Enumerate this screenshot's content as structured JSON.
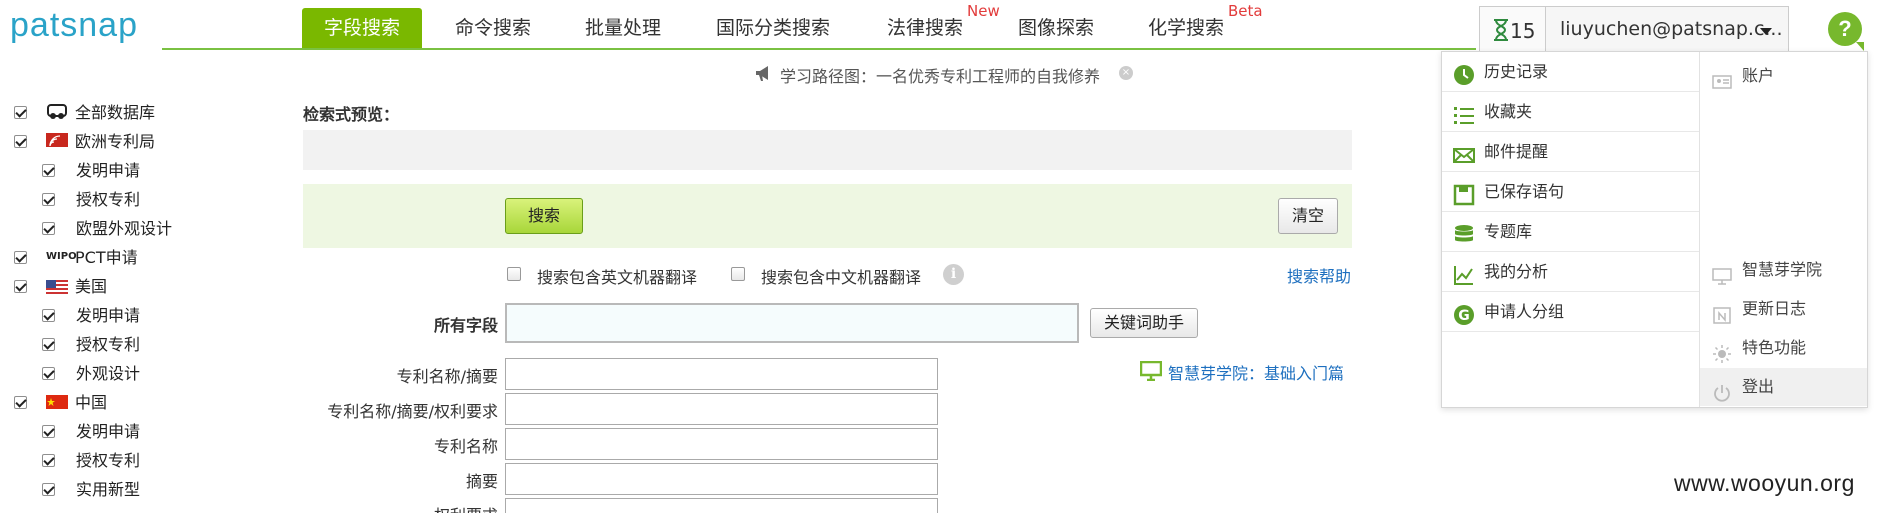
{
  "logo": "patsnap",
  "tabs": [
    {
      "label": "字段搜索",
      "active": true
    },
    {
      "label": "命令搜索"
    },
    {
      "label": "批量处理"
    },
    {
      "label": "国际分类搜索"
    },
    {
      "label": "法律搜索",
      "badge": "New"
    },
    {
      "label": "图像探索"
    },
    {
      "label": "化学搜索",
      "badge": "Beta"
    }
  ],
  "header": {
    "timer_count": "15",
    "user": "liuyuchen@patsnap.c...",
    "help": "?"
  },
  "notice": {
    "text": "学习路径图：一名优秀专利工程师的自我修养",
    "close": "×"
  },
  "databases": [
    {
      "label": "全部数据库",
      "checked": true
    },
    {
      "label": "欧洲专利局",
      "checked": true,
      "children": [
        {
          "label": "发明申请",
          "checked": true
        },
        {
          "label": "授权专利",
          "checked": true
        },
        {
          "label": "欧盟外观设计",
          "checked": true
        }
      ]
    },
    {
      "label": "PCT申请",
      "checked": true,
      "logo": "WIPO"
    },
    {
      "label": "美国",
      "checked": true,
      "children": [
        {
          "label": "发明申请",
          "checked": true
        },
        {
          "label": "授权专利",
          "checked": true
        },
        {
          "label": "外观设计",
          "checked": true
        }
      ]
    },
    {
      "label": "中国",
      "checked": true,
      "children": [
        {
          "label": "发明申请",
          "checked": true
        },
        {
          "label": "授权专利",
          "checked": true
        },
        {
          "label": "实用新型",
          "checked": true
        }
      ]
    }
  ],
  "main": {
    "preview_label": "检索式预览：",
    "search_button": "搜索",
    "clear_button": "清空",
    "option_en": "搜索包含英文机器翻译",
    "option_cn": "搜索包含中文机器翻译",
    "search_help": "搜索帮助",
    "all_fields_label": "所有字段",
    "keyword_helper": "关键词助手",
    "academy_link": "智慧芽学院：基础入门篇",
    "fields": [
      "专利名称/摘要",
      "专利名称/摘要/权利要求",
      "专利名称",
      "摘要",
      "权利要求"
    ]
  },
  "dropdown": {
    "left": [
      {
        "label": "历史记录",
        "icon": "clock-icon"
      },
      {
        "label": "收藏夹",
        "icon": "list-icon"
      },
      {
        "label": "邮件提醒",
        "icon": "mail-icon"
      },
      {
        "label": "已保存语句",
        "icon": "save-icon"
      },
      {
        "label": "专题库",
        "icon": "database-icon"
      },
      {
        "label": "我的分析",
        "icon": "chart-icon"
      },
      {
        "label": "申请人分组",
        "icon": "group-icon"
      }
    ],
    "right": [
      {
        "label": "账户",
        "icon": "account-card-icon"
      },
      {
        "label": "智慧芽学院",
        "icon": "monitor-icon"
      },
      {
        "label": "更新日志",
        "icon": "calendar-icon"
      },
      {
        "label": "特色功能",
        "icon": "sun-icon"
      },
      {
        "label": "登出",
        "icon": "power-icon"
      }
    ]
  },
  "colors": {
    "accent": "#7ab800",
    "link": "#1d6fbf",
    "logo": "#2aa3c8",
    "badge": "#e23b3b"
  },
  "watermark": "www.wooyun.org"
}
